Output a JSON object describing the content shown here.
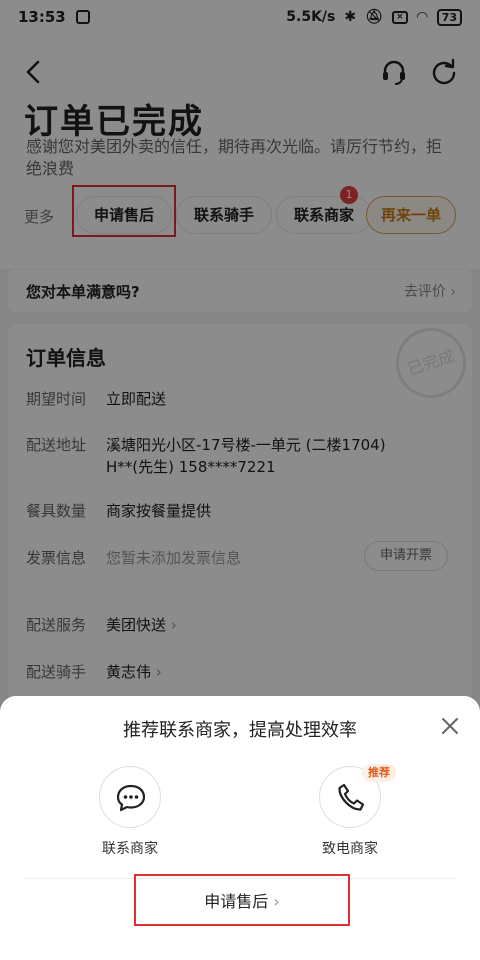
{
  "status_bar": {
    "time": "13:53",
    "net_speed": "5.5K/s",
    "battery": "73"
  },
  "header": {
    "title": "订单已完成",
    "subtitle": "感谢您对美团外卖的信任，期待再次光临。请厉行节约，拒绝浪费"
  },
  "actions": {
    "more": "更多",
    "after_sale": "申请售后",
    "contact_rider": "联系骑手",
    "contact_merchant": "联系商家",
    "merchant_badge": "1",
    "reorder": "再来一单"
  },
  "satisfaction": {
    "question": "您对本单满意吗?",
    "rate_link": "去评价"
  },
  "order_info": {
    "title": "订单信息",
    "stamp": "已完成",
    "rows": [
      {
        "label": "期望时间",
        "value": "立即配送"
      },
      {
        "label": "配送地址",
        "value": "溪塘阳光小区-17号楼-一单元 (二楼1704)",
        "value2": "H**(先生) 158****7221"
      },
      {
        "label": "餐具数量",
        "value": "商家按餐量提供"
      },
      {
        "label": "发票信息",
        "value": "您暂未添加发票信息",
        "button": "申请开票"
      },
      {
        "label": "配送服务",
        "value": "美团快送"
      },
      {
        "label": "配送骑手",
        "value": "黄志伟"
      }
    ]
  },
  "sheet": {
    "title": "推荐联系商家，提高处理效率",
    "contact_merchant": "联系商家",
    "call_merchant": "致电商家",
    "recommend_tag": "推荐",
    "after_sale": "申请售后"
  }
}
